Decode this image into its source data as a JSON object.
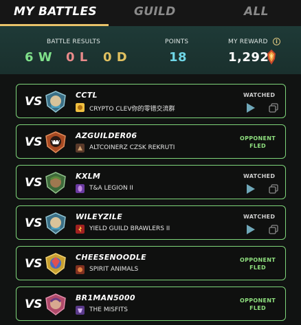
{
  "tabs": [
    {
      "label": "MY BATTLES",
      "active": true
    },
    {
      "label": "GUILD",
      "active": false
    },
    {
      "label": "ALL",
      "active": false
    }
  ],
  "stats": {
    "results_label": "BATTLE RESULTS",
    "wins": "6 W",
    "losses": "0 L",
    "draws": "0 D",
    "points_label": "POINTS",
    "points": "18",
    "reward_label": "MY REWARD",
    "reward": "1,292",
    "info_icon": "i"
  },
  "battles": [
    {
      "vs": "VS",
      "opponent": "CCTL",
      "guild": "CRYPTO CLEV你的零错交流群",
      "status": "watched",
      "status_label": "WATCHED"
    },
    {
      "vs": "VS",
      "opponent": "AZGUILDER06",
      "guild": "ALTCOINERZ CZSK REKRUTI",
      "status": "fled",
      "status_line1": "OPPONENT",
      "status_line2": "FLED"
    },
    {
      "vs": "VS",
      "opponent": "KXLM",
      "guild": "T&A LEGION II",
      "status": "watched",
      "status_label": "WATCHED"
    },
    {
      "vs": "VS",
      "opponent": "WILEYZILE",
      "guild": "YIELD GUILD BRAWLERS II",
      "status": "watched",
      "status_label": "WATCHED"
    },
    {
      "vs": "VS",
      "opponent": "CHEESENOODLE",
      "guild": "SPIRIT ANIMALS",
      "status": "fled",
      "status_line1": "OPPONENT",
      "status_line2": "FLED"
    },
    {
      "vs": "VS",
      "opponent": "BR1MAN5000",
      "guild": "THE MISFITS",
      "status": "fled",
      "status_line1": "OPPONENT",
      "status_line2": "FLED"
    }
  ],
  "colors": {
    "accent_gold": "#e9c36a",
    "win": "#7fe08a",
    "loss": "#e98a8a",
    "draw": "#e0c060",
    "points": "#6fd6e6",
    "card_border": "#7fd67b"
  }
}
